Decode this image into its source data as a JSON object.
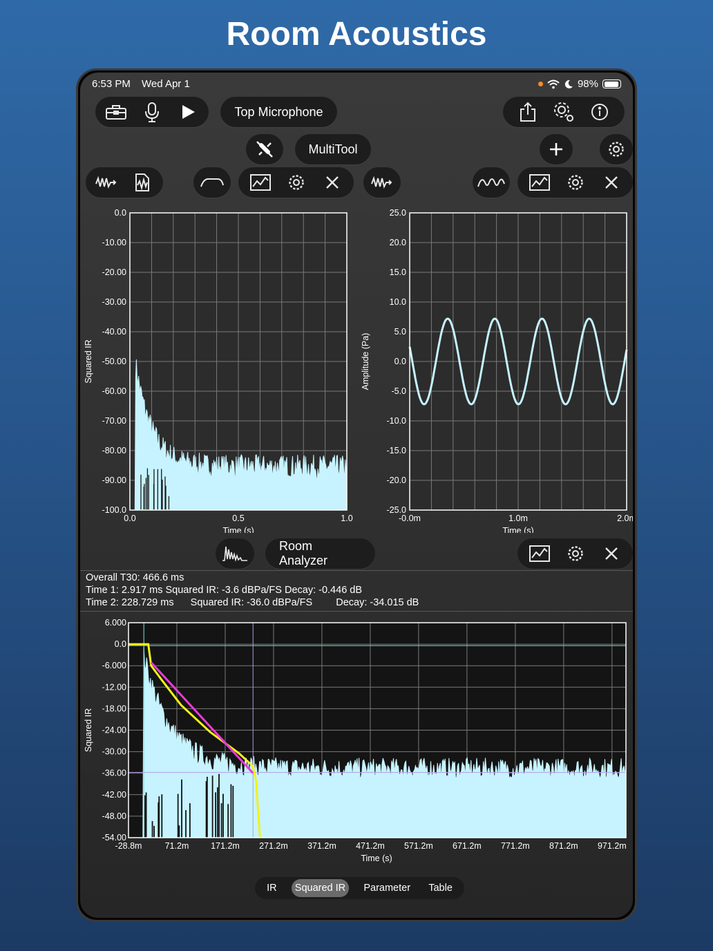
{
  "headline": "Room Acoustics",
  "status": {
    "time": "6:53 PM",
    "date": "Wed Apr 1",
    "battery": "98%"
  },
  "toolbar": {
    "source_label": "Top Microphone"
  },
  "multitool": {
    "label": "MultiTool"
  },
  "analyzer": {
    "label": "Room Analyzer"
  },
  "info": {
    "overall": "Overall T30:  466.6 ms",
    "line1": "Time 1: 2.917 ms Squared IR: -3.6 dBPa/FS Decay: -0.446 dB",
    "line2_a": "Time 2: 228.729 ms",
    "line2_b": "Squared IR: -36.0 dBPa/FS",
    "line2_c": "Decay: -34.015 dB"
  },
  "tabs": [
    "IR",
    "Squared IR",
    "Parameter",
    "Table"
  ],
  "active_tab": "Squared IR",
  "colors": {
    "trace": "#c6f3ff",
    "grid": "#7a7a7a",
    "yellow": "#f2f21a",
    "magenta": "#e83ad6"
  },
  "chart_data": [
    {
      "type": "area",
      "ylabel": "Squared IR",
      "xlabel": "Time (s)",
      "ylim": [
        -100,
        0
      ],
      "xlim": [
        0,
        1
      ],
      "yticks": [
        "0.0",
        "-10.00",
        "-20.00",
        "-30.00",
        "-40.00",
        "-50.00",
        "-60.00",
        "-70.00",
        "-80.00",
        "-90.00",
        "-100.0"
      ],
      "xticks": [
        "0.0",
        "0.5",
        "1.0"
      ],
      "peak_db": -52,
      "noise_floor_db": -87
    },
    {
      "type": "line",
      "ylabel": "Amplitude (Pa)",
      "xlabel": "Time (s)",
      "ylim": [
        -25,
        25
      ],
      "xticks": [
        "-0.0m",
        "1.0m",
        "2.0m"
      ],
      "yticks": [
        "25.0",
        "20.0",
        "15.0",
        "10.0",
        "5.0",
        "0.0",
        "-5.0",
        "-10.0",
        "-15.0",
        "-20.0",
        "-25.0"
      ],
      "amplitude": 7.2,
      "cycles": 4.6
    },
    {
      "type": "area",
      "ylabel": "Squared IR",
      "xlabel": "Time (s)",
      "ylim": [
        -54,
        6
      ],
      "yticks": [
        "6.000",
        "0.0",
        "-6.000",
        "-12.00",
        "-18.00",
        "-24.00",
        "-30.00",
        "-36.00",
        "-42.00",
        "-48.00",
        "-54.00"
      ],
      "xticks": [
        "-28.8m",
        "71.2m",
        "171.2m",
        "271.2m",
        "371.2m",
        "471.2m",
        "571.2m",
        "671.2m",
        "771.2m",
        "871.2m",
        "971.2m"
      ],
      "marker_time1_ms": 2.917,
      "marker_time2_ms": 228.729,
      "decay_start_db": -3.6,
      "decay_end_db": -36.0,
      "noise_floor_db": -35
    }
  ]
}
